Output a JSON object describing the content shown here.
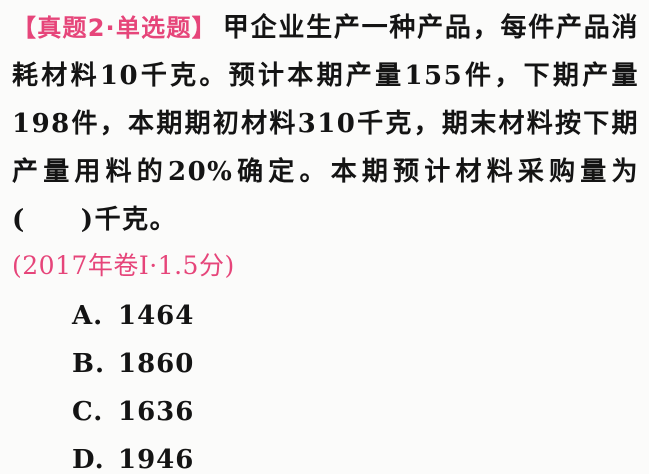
{
  "question": {
    "tag": "【真题2·单选题】",
    "stem": "甲企业生产一种产品，每件产品消耗材料10千克。预计本期产量155件，下期产量198件，本期期初材料310千克，期末材料按下期产量用料的20%确定。本期预计材料采购量为(　　)千克。",
    "source": "(2017年卷Ⅰ·1.5分)"
  },
  "options": [
    {
      "letter": "A.",
      "value": "1464"
    },
    {
      "letter": "B.",
      "value": "1860"
    },
    {
      "letter": "C.",
      "value": "1636"
    },
    {
      "letter": "D.",
      "value": "1946"
    }
  ]
}
